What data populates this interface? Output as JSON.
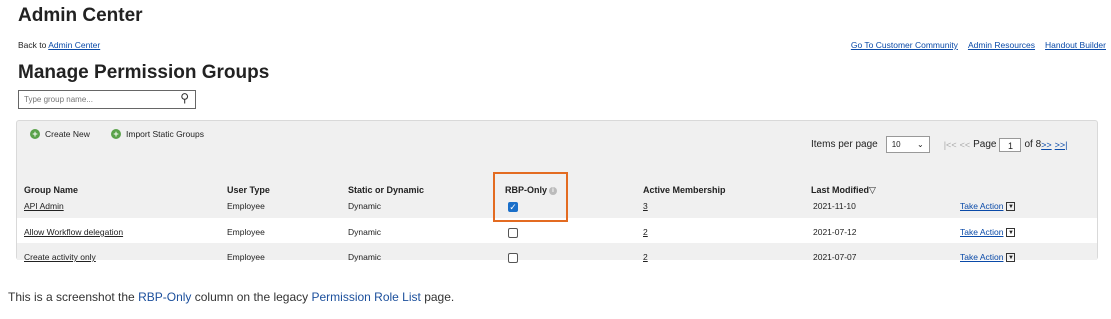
{
  "header": {
    "title": "Admin Center",
    "back_prefix": "Back to ",
    "back_link": "Admin Center",
    "top_links": [
      "Go To Customer Community",
      "Admin Resources",
      "Handout Builder"
    ],
    "subtitle": "Manage Permission Groups"
  },
  "search": {
    "placeholder": "Type group name..."
  },
  "toolbar": {
    "create_new": "Create New",
    "import_static": "Import Static Groups",
    "items_per_page_label": "Items per page",
    "items_per_page_value": "10",
    "page_label": "Page",
    "page_value": "1",
    "page_total": "of 8",
    "nav_first": "|<<",
    "nav_prev": "<<",
    "nav_next": ">>",
    "nav_last": ">>|"
  },
  "table": {
    "columns": [
      "Group Name",
      "User Type",
      "Static or Dynamic",
      "RBP-Only",
      "Active Membership",
      "Last Modified"
    ],
    "sort_indicator": "▽",
    "rows": [
      {
        "name": "API Admin",
        "user_type": "Employee",
        "kind": "Dynamic",
        "rbp_only": true,
        "membership": "3",
        "modified": "2021-11-10",
        "action": "Take Action"
      },
      {
        "name": "Allow Workflow delegation",
        "user_type": "Employee",
        "kind": "Dynamic",
        "rbp_only": false,
        "membership": "2",
        "modified": "2021-07-12",
        "action": "Take Action"
      },
      {
        "name": "Create activity only",
        "user_type": "Employee",
        "kind": "Dynamic",
        "rbp_only": false,
        "membership": "2",
        "modified": "2021-07-07",
        "action": "Take Action"
      }
    ]
  },
  "caption": {
    "part1": "This is a screenshot the ",
    "hl1": "RBP-Only",
    "part2": " column on the legacy ",
    "hl2": "Permission Role List",
    "part3": " page."
  },
  "colors": {
    "accent": "#e36b21",
    "link": "#0a4aa8",
    "check": "#1a6fc9",
    "add_icon": "#5aa24a"
  }
}
